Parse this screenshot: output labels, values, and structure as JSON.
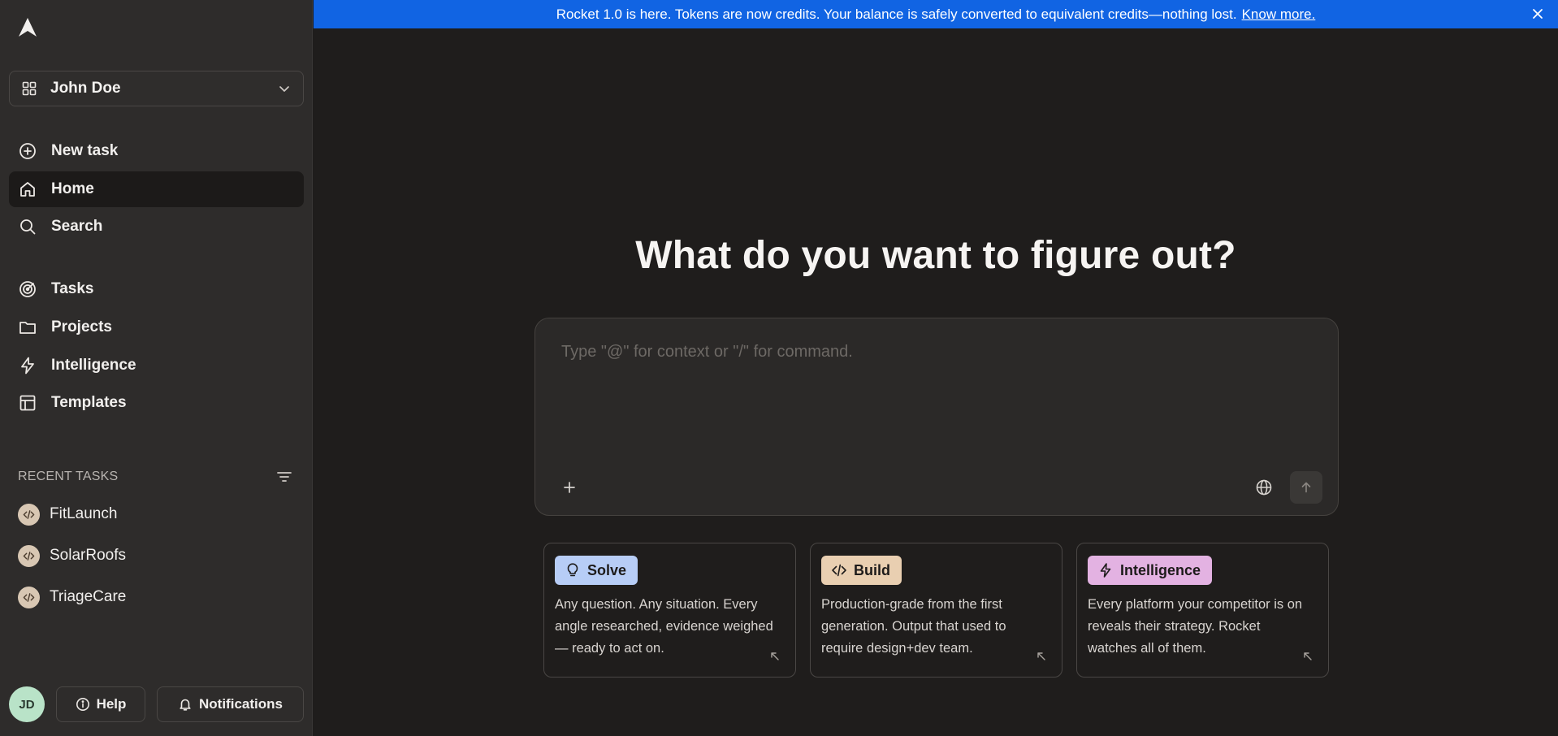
{
  "sidebar": {
    "workspace": {
      "name": "John Doe"
    },
    "nav": [
      {
        "label": "New task",
        "icon": "plus-circle-icon"
      },
      {
        "label": "Home",
        "icon": "home-icon",
        "active": true
      },
      {
        "label": "Search",
        "icon": "search-icon"
      },
      {
        "label": "Tasks",
        "icon": "target-icon"
      },
      {
        "label": "Projects",
        "icon": "folder-icon"
      },
      {
        "label": "Intelligence",
        "icon": "lightning-icon"
      },
      {
        "label": "Templates",
        "icon": "layout-icon"
      }
    ],
    "recent": {
      "title": "RECENT TASKS",
      "items": [
        {
          "label": "FitLaunch"
        },
        {
          "label": "SolarRoofs"
        },
        {
          "label": "TriageCare"
        }
      ]
    },
    "footer": {
      "avatar_initials": "JD",
      "help_label": "Help",
      "notifications_label": "Notifications"
    }
  },
  "banner": {
    "text": "Rocket 1.0 is here. Tokens are now credits. Your balance is safely converted to equivalent credits—nothing lost.",
    "link": "Know more."
  },
  "main": {
    "heading": "What do you want to figure out?",
    "composer": {
      "placeholder": "Type \"@\" for context or \"/\" for command."
    },
    "cards": [
      {
        "label": "Solve",
        "icon": "lightbulb-icon",
        "color": "#b7cdf6",
        "description": "Any question. Any situation. Every angle researched, evidence weighed — ready to act on."
      },
      {
        "label": "Build",
        "icon": "code-icon",
        "color": "#e9cfb1",
        "description": "Production-grade from the first generation. Output that used to require design+dev team."
      },
      {
        "label": "Intelligence",
        "icon": "lightning-icon",
        "color": "#e3b2e2",
        "description": "Every platform your competitor is on reveals their strategy. Rocket watches all of them."
      }
    ]
  },
  "colors": {
    "sidebar_bg": "#2e2c2b",
    "main_bg": "#1f1d1c",
    "banner_bg": "#1164e3"
  }
}
